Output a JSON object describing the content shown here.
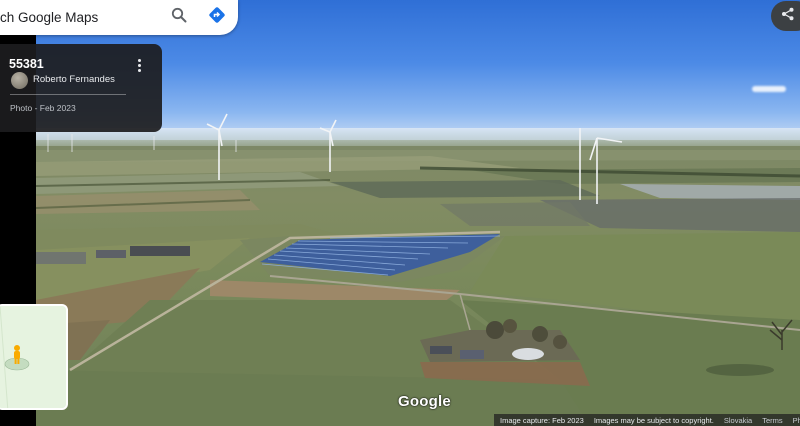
{
  "search": {
    "text": "ch Google Maps"
  },
  "photo_card": {
    "title": "55381",
    "author": "Roberto Fernandes",
    "date": "Photo - Feb 2023"
  },
  "branding": {
    "google_logo": "Google"
  },
  "attribution": {
    "capture": "Image capture: Feb 2023",
    "copyright": "Images may be subject to copyright.",
    "country": "Slovakia",
    "terms": "Terms",
    "privacy": "Ph"
  },
  "icons": {
    "search": "search-icon",
    "directions": "directions-icon",
    "menu": "more-vert-icon",
    "share": "share-icon",
    "pegman": "pegman-icon"
  },
  "colors": {
    "directions_accent": "#1a73e8",
    "pegman": "#f9ab00",
    "card_bg": "#1c1c1e"
  }
}
